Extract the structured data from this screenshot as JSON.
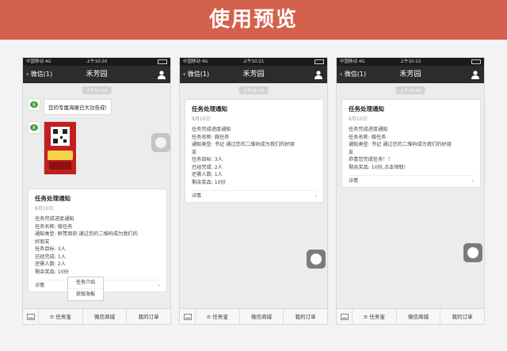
{
  "banner": {
    "title": "使用预览"
  },
  "colors": {
    "banner": "#d4614c",
    "navbar": "#2c2c2c",
    "poster": "#c21f1f"
  },
  "phones": [
    {
      "status": {
        "carrier": "中国移动  4G",
        "time": "上午10:20"
      },
      "nav": {
        "back": "微信(1)",
        "title": "禾芳园"
      },
      "timestamp": "上午10:19",
      "bubble_text": "您的专属海报已大功告成!",
      "card": {
        "title": "任务处理通知",
        "date": "8月10日",
        "lines": [
          "任务完成进度通知",
          "任务名称:  做任务",
          "通知类型:  醉赞周凯 通过您的二维码成为我们的",
          "好朋友",
          "任务目标:  3人",
          "已经完成:  1人",
          "还需人数:  2人",
          "剩余奖品:  10份"
        ],
        "detail": "详情"
      },
      "popup": [
        "任务介绍",
        "获取海报"
      ],
      "menu": [
        "任务宝",
        "微信商城",
        "我的订单"
      ]
    },
    {
      "status": {
        "carrier": "中国移动  4G",
        "time": "上午10:21"
      },
      "nav": {
        "back": "微信(1)",
        "title": "禾芳园"
      },
      "timestamp": "上午10:19",
      "card": {
        "title": "任务处理通知",
        "date": "8月10日",
        "lines": [
          "任务完成进度通知",
          "任务名称:  做任务",
          "通知类型:  书记 通过您的二维码成为我们的好朋",
          "友",
          "任务目标:  3人",
          "已经完成:  2人",
          "还需人数:  1人",
          "剩余奖品:  10份"
        ],
        "detail": "详情"
      },
      "menu": [
        "任务宝",
        "微信商城",
        "我的订单"
      ]
    },
    {
      "status": {
        "carrier": "中国移动  4G",
        "time": "上午10:22"
      },
      "nav": {
        "back": "微信(1)",
        "title": "禾芳园"
      },
      "timestamp": "上午10:20",
      "card": {
        "title": "任务处理通知",
        "date": "8月10日",
        "lines": [
          "任务完成进度通知",
          "任务名称:  做任务",
          "通知类型:  书记 通过您的二维码成为我们的好朋",
          "友",
          "恭喜您完成任务！！",
          "剩余奖品:  10份,点击领取!"
        ],
        "detail": "详情"
      },
      "menu": [
        "任务宝",
        "微信商城",
        "我的订单"
      ]
    }
  ]
}
